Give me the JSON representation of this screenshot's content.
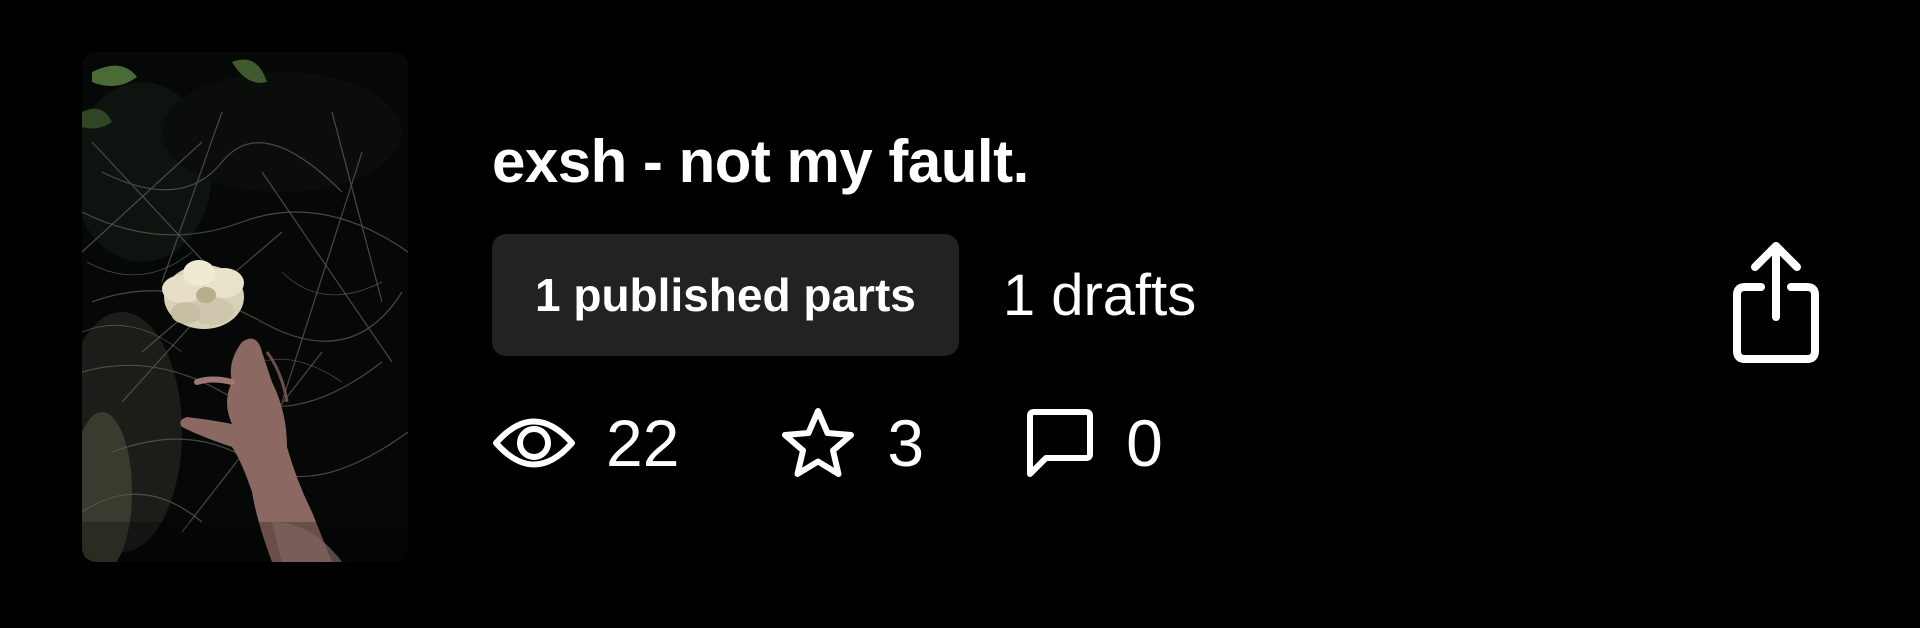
{
  "story": {
    "title": "exsh - not my fault.",
    "published_parts": "1 published parts",
    "drafts": "1 drafts"
  },
  "stats": {
    "views": "22",
    "votes": "3",
    "comments": "0"
  },
  "icons": {
    "views": "eye-icon",
    "votes": "star-icon",
    "comments": "comment-icon",
    "share": "share-icon"
  },
  "colors": {
    "background": "#000000",
    "text": "#ffffff",
    "pill_background": "#222222"
  }
}
